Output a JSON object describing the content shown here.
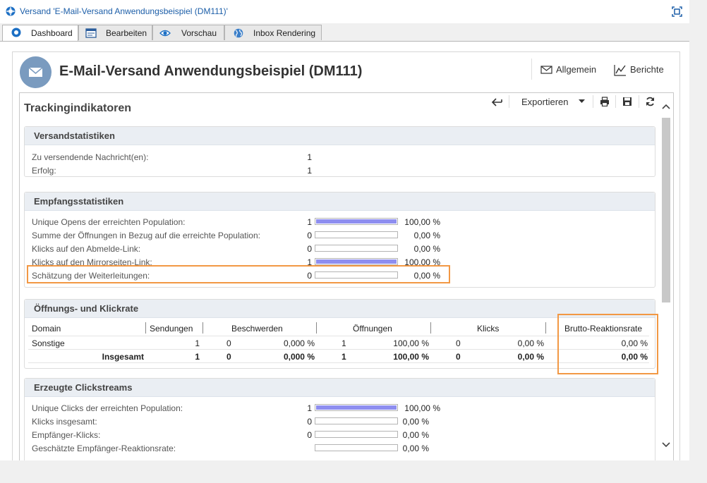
{
  "window": {
    "title": "Versand 'E-Mail-Versand Anwendungsbeispiel (DM111)'"
  },
  "tabs": [
    {
      "label": "Dashboard",
      "icon": "dashboard-icon",
      "active": true
    },
    {
      "label": "Bearbeiten",
      "icon": "edit-window-icon"
    },
    {
      "label": "Vorschau",
      "icon": "eye-icon"
    },
    {
      "label": "Inbox Rendering",
      "icon": "globe-icon"
    }
  ],
  "header": {
    "title": "E-Mail-Versand Anwendungsbeispiel (DM111)",
    "general_label": "Allgemein",
    "reports_label": "Berichte"
  },
  "panel": {
    "title": "Trackingindikatoren",
    "toolbar": {
      "export_label": "Exportieren"
    }
  },
  "colors": {
    "accent": "#1c5ea8",
    "highlight": "#f29844",
    "bar_fill": "#8e8ef0"
  },
  "delivery_stats": {
    "title": "Versandstatistiken",
    "rows": [
      {
        "label": "Zu versendende Nachricht(en):",
        "value": "1"
      },
      {
        "label": "Erfolg:",
        "value": "1"
      }
    ]
  },
  "reception_stats": {
    "title": "Empfangsstatistiken",
    "rows": [
      {
        "label": "Unique Opens der erreichten Population:",
        "value": "1",
        "pct": "100,00 %",
        "fill": 1.0
      },
      {
        "label": "Summe der Öffnungen in Bezug auf die erreichte Population:",
        "value": "0",
        "pct": "0,00 %",
        "fill": 0
      },
      {
        "label": "Klicks auf den Abmelde-Link:",
        "value": "0",
        "pct": "0,00 %",
        "fill": 0
      },
      {
        "label": "Klicks auf den Mirrorseiten-Link:",
        "value": "1",
        "pct": "100,00 %",
        "fill": 1.0
      },
      {
        "label": "Schätzung der Weiterleitungen:",
        "value": "0",
        "pct": "0,00 %",
        "fill": 0
      }
    ]
  },
  "open_click_rate": {
    "title": "Öffnungs- und Klickrate",
    "columns": [
      "Domain",
      "Sendungen",
      "Beschwerden",
      "Öffnungen",
      "Klicks",
      "Brutto-Reaktionsrate"
    ],
    "rows": [
      {
        "domain": "Sonstige",
        "sent": "1",
        "complaints": "0",
        "complaints_pct": "0,000 %",
        "opens": "1",
        "opens_pct": "100,00 %",
        "clicks": "0",
        "clicks_pct": "0,00 %",
        "gross_rate": "0,00 %"
      },
      {
        "domain": "Insgesamt",
        "sent": "1",
        "complaints": "0",
        "complaints_pct": "0,000 %",
        "opens": "1",
        "opens_pct": "100,00 %",
        "clicks": "0",
        "clicks_pct": "0,00 %",
        "gross_rate": "0,00 %"
      }
    ]
  },
  "clickstreams": {
    "title": "Erzeugte Clickstreams",
    "rows": [
      {
        "label": "Unique Clicks der erreichten Population:",
        "value": "1",
        "pct": "100,00 %",
        "fill": 1.0
      },
      {
        "label": "Klicks insgesamt:",
        "value": "0",
        "pct": "0,00 %",
        "fill": 0
      },
      {
        "label": "Empfänger-Klicks:",
        "value": "0",
        "pct": "0,00 %",
        "fill": 0
      },
      {
        "label": "Geschätzte Empfänger-Reaktionsrate:",
        "value": "",
        "pct": "0,00 %",
        "fill": 0
      }
    ]
  }
}
